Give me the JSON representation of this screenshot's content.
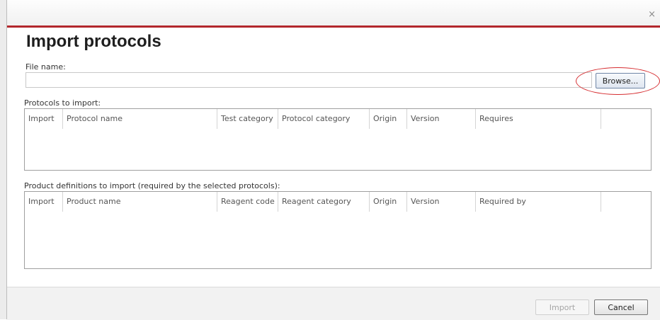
{
  "dialog": {
    "title": "Import protocols",
    "close_icon": "close-icon"
  },
  "file": {
    "label": "File name:",
    "value": "",
    "browse_label": "Browse..."
  },
  "protocols": {
    "label": "Protocols to import:",
    "columns": [
      "Import",
      "Protocol name",
      "Test category",
      "Protocol category",
      "Origin",
      "Version",
      "Requires",
      ""
    ]
  },
  "products": {
    "label": "Product definitions to import (required by the selected protocols):",
    "columns": [
      "Import",
      "Product name",
      "Reagent code",
      "Reagent category",
      "Origin",
      "Version",
      "Required by",
      ""
    ]
  },
  "footer": {
    "import_label": "Import",
    "cancel_label": "Cancel"
  },
  "colors": {
    "accent": "#b3282d",
    "highlight": "#d62d30"
  }
}
